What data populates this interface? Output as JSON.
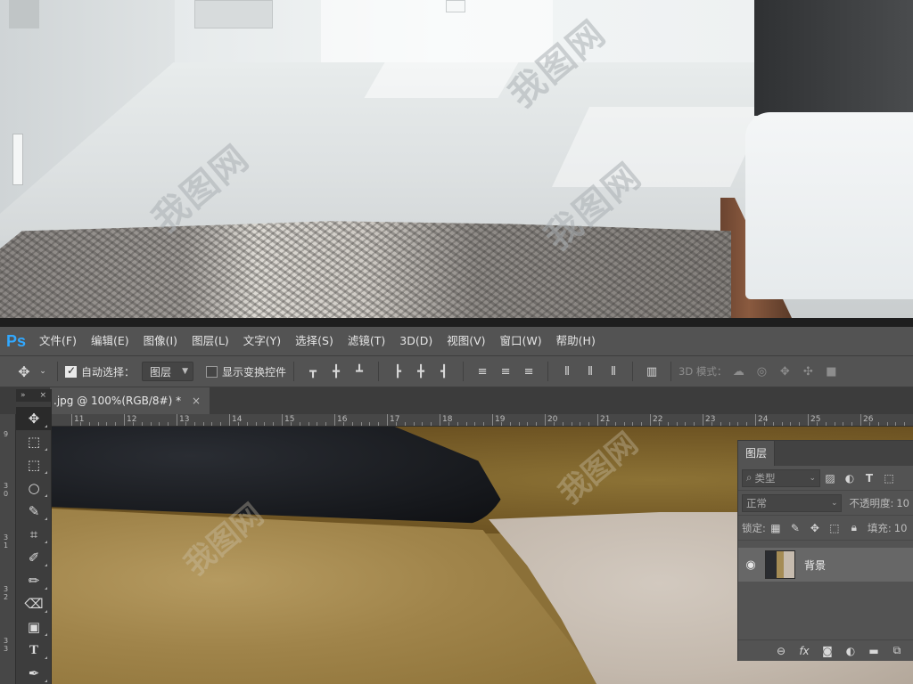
{
  "app": {
    "logo": "Ps"
  },
  "menu": [
    "文件(F)",
    "编辑(E)",
    "图像(I)",
    "图层(L)",
    "文字(Y)",
    "选择(S)",
    "滤镜(T)",
    "3D(D)",
    "视图(V)",
    "窗口(W)",
    "帮助(H)"
  ],
  "options": {
    "move_icon": "move-arrows-icon",
    "auto_select_label": "自动选择：",
    "auto_select_checked": true,
    "auto_select_target": "图层",
    "show_transform_label": "显示变换控件",
    "show_transform_checked": false,
    "mode_3d_label": "3D 模式："
  },
  "document": {
    "tab_title": ".jpg @ 100%(RGB/8#) *",
    "close_glyph": "×"
  },
  "toolbox": {
    "collapse": "»",
    "close": "×"
  },
  "ruler": {
    "numbers": [
      "11",
      "12",
      "13",
      "14",
      "15",
      "16",
      "17",
      "18",
      "19",
      "20",
      "21",
      "22",
      "23",
      "24",
      "25",
      "26"
    ]
  },
  "vruler": {
    "numbers": [
      "9",
      "3 0",
      "3 1",
      "3 2",
      "3 3"
    ]
  },
  "layers_panel": {
    "tab": "图层",
    "filter_kind": "类型",
    "blend_mode": "正常",
    "opacity_label": "不透明度:",
    "opacity_value": "10",
    "lock_label": "锁定:",
    "fill_label": "填充:",
    "fill_value": "10",
    "layers": [
      {
        "name": "背景",
        "visible": true
      }
    ]
  },
  "watermark": "我图网"
}
